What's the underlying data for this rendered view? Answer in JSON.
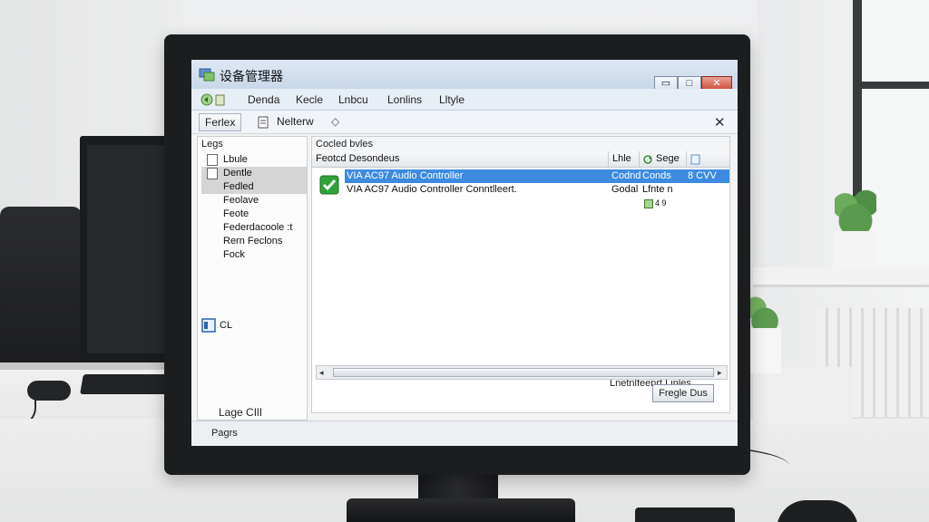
{
  "window": {
    "title": "设备管理器",
    "minimize_glyph": "▭",
    "maximize_glyph": "□",
    "close_glyph": "✕"
  },
  "menu": {
    "items": [
      "Denda",
      "Kecle",
      "Lnbcu",
      "Lonlins",
      "Lltyle"
    ]
  },
  "toolbar": {
    "button1_label": "Ferlex",
    "button2_label": "Nelterw",
    "nav_glyph": "◇",
    "close_glyph": "✕"
  },
  "nav": {
    "header": "Legs",
    "items": [
      {
        "label": "Lbule",
        "selected": false
      },
      {
        "label": "Dentle",
        "selected": true
      },
      {
        "label": "Fedled",
        "selected": true
      },
      {
        "label": "Feolave",
        "selected": false
      },
      {
        "label": "Feote",
        "selected": false
      },
      {
        "label": "Federdacoole :t",
        "selected": false
      },
      {
        "label": "Rern Feclons",
        "selected": false
      },
      {
        "label": "Fock",
        "selected": false
      }
    ],
    "footer_label": "CL"
  },
  "content": {
    "title": "Cocled bvles",
    "columns": [
      "Feotcd Desondeus",
      "Lhle",
      "Sege",
      ""
    ],
    "rows": [
      {
        "name": "VIA AC97 Audio Controller",
        "col2": "Codnd",
        "col3": "Conds",
        "col4": "8 CVV"
      },
      {
        "name": "VIA AC97 Audio Controller Conntlleert.",
        "col2": "Godal",
        "col3": "Lfnte n",
        "col4": ""
      }
    ],
    "extra_value": "4 9",
    "footer_label": "Lnetnlfeenrt Linles",
    "footer_button": "Fregle Dus"
  },
  "bottom": {
    "left_label": "Lage CIlI",
    "status": "Pagrs"
  },
  "colors": {
    "selection": "#3d8be0",
    "title_bar": "#c9d7e8",
    "close_button": "#c9452e",
    "check_green": "#2fa33a"
  }
}
